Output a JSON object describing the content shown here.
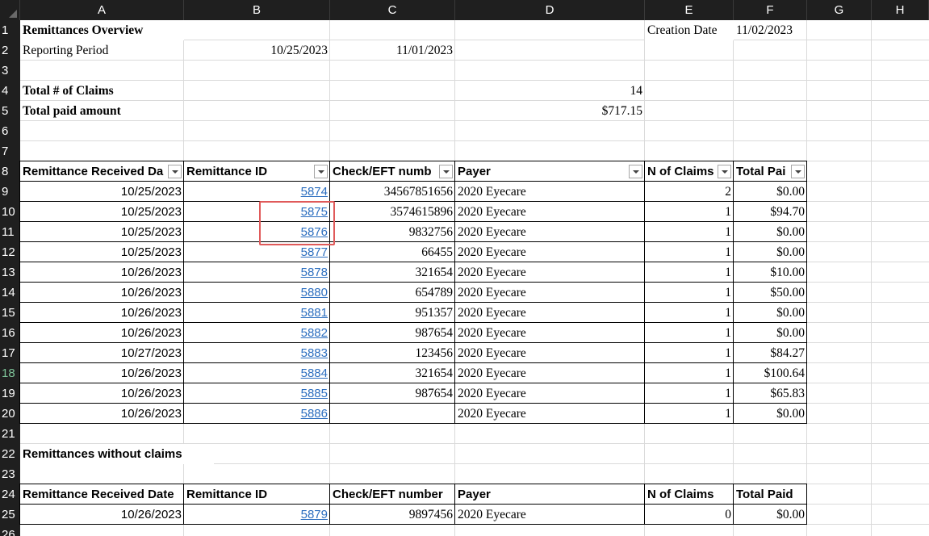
{
  "columns": [
    "A",
    "B",
    "C",
    "D",
    "E",
    "F",
    "G",
    "H"
  ],
  "rows": [
    "1",
    "2",
    "3",
    "4",
    "5",
    "6",
    "7",
    "8",
    "9",
    "10",
    "11",
    "12",
    "13",
    "14",
    "15",
    "16",
    "17",
    "18",
    "19",
    "20",
    "21",
    "22",
    "23",
    "24",
    "25",
    "26"
  ],
  "overview": {
    "title": "Remittances Overview",
    "creation_label": "Creation Date",
    "creation_date": "11/02/2023",
    "period_label": "Reporting Period",
    "period_start": "10/25/2023",
    "period_end": "11/01/2023",
    "total_claims_label": "Total # of Claims",
    "total_claims": "14",
    "total_paid_label": "Total paid amount",
    "total_paid": "$717.15"
  },
  "main_table": {
    "headers": [
      "Remittance Received Da",
      "Remittance ID",
      "Check/EFT numb",
      "Payer",
      "N of Claims",
      "Total Pai"
    ],
    "rows": [
      [
        "10/25/2023",
        "5874",
        "34567851656",
        "2020 Eyecare",
        "2",
        "$0.00"
      ],
      [
        "10/25/2023",
        "5875",
        "3574615896",
        "2020 Eyecare",
        "1",
        "$94.70"
      ],
      [
        "10/25/2023",
        "5876",
        "9832756",
        "2020 Eyecare",
        "1",
        "$0.00"
      ],
      [
        "10/25/2023",
        "5877",
        "66455",
        "2020 Eyecare",
        "1",
        "$0.00"
      ],
      [
        "10/26/2023",
        "5878",
        "321654",
        "2020 Eyecare",
        "1",
        "$10.00"
      ],
      [
        "10/26/2023",
        "5880",
        "654789",
        "2020 Eyecare",
        "1",
        "$50.00"
      ],
      [
        "10/26/2023",
        "5881",
        "951357",
        "2020 Eyecare",
        "1",
        "$0.00"
      ],
      [
        "10/26/2023",
        "5882",
        "987654",
        "2020 Eyecare",
        "1",
        "$0.00"
      ],
      [
        "10/27/2023",
        "5883",
        "123456",
        "2020 Eyecare",
        "1",
        "$84.27"
      ],
      [
        "10/26/2023",
        "5884",
        "321654",
        "2020 Eyecare",
        "1",
        "$100.64"
      ],
      [
        "10/26/2023",
        "5885",
        "987654",
        "2020 Eyecare",
        "1",
        "$65.83"
      ],
      [
        "10/26/2023",
        "5886",
        "",
        "2020 Eyecare",
        "1",
        "$0.00"
      ]
    ]
  },
  "no_claims": {
    "title": "Remittances without claims",
    "headers": [
      "Remittance Received Date",
      "Remittance ID",
      "Check/EFT number",
      "Payer",
      "N of Claims",
      "Total Paid"
    ],
    "rows": [
      [
        "10/26/2023",
        "5879",
        "9897456",
        "2020 Eyecare",
        "0",
        "$0.00"
      ]
    ]
  },
  "colors": {
    "header_bg": "#1f1f1f",
    "link": "#2c6ebf",
    "highlight": "#e05a5a",
    "active_row": "#7fc59a"
  }
}
